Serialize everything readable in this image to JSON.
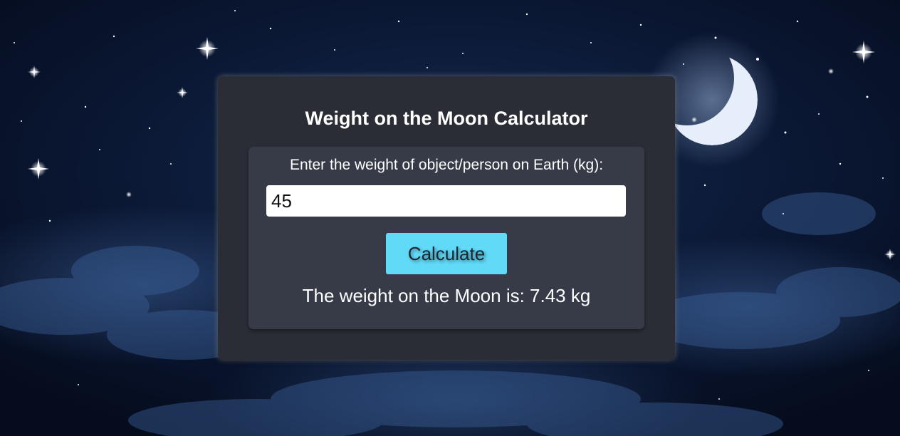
{
  "calculator": {
    "title": "Weight on the Moon Calculator",
    "input_label": "Enter the weight of object/person on Earth (kg):",
    "input_value": "45",
    "button_label": "Calculate",
    "result_text": "The weight on the Moon is: 7.43 kg"
  },
  "colors": {
    "card_background": "#2a2d35",
    "inner_panel": "#363b47",
    "button": "#61daf8",
    "sky": "#0a1631"
  },
  "icons": {
    "background": "night-sky-moon-background"
  }
}
